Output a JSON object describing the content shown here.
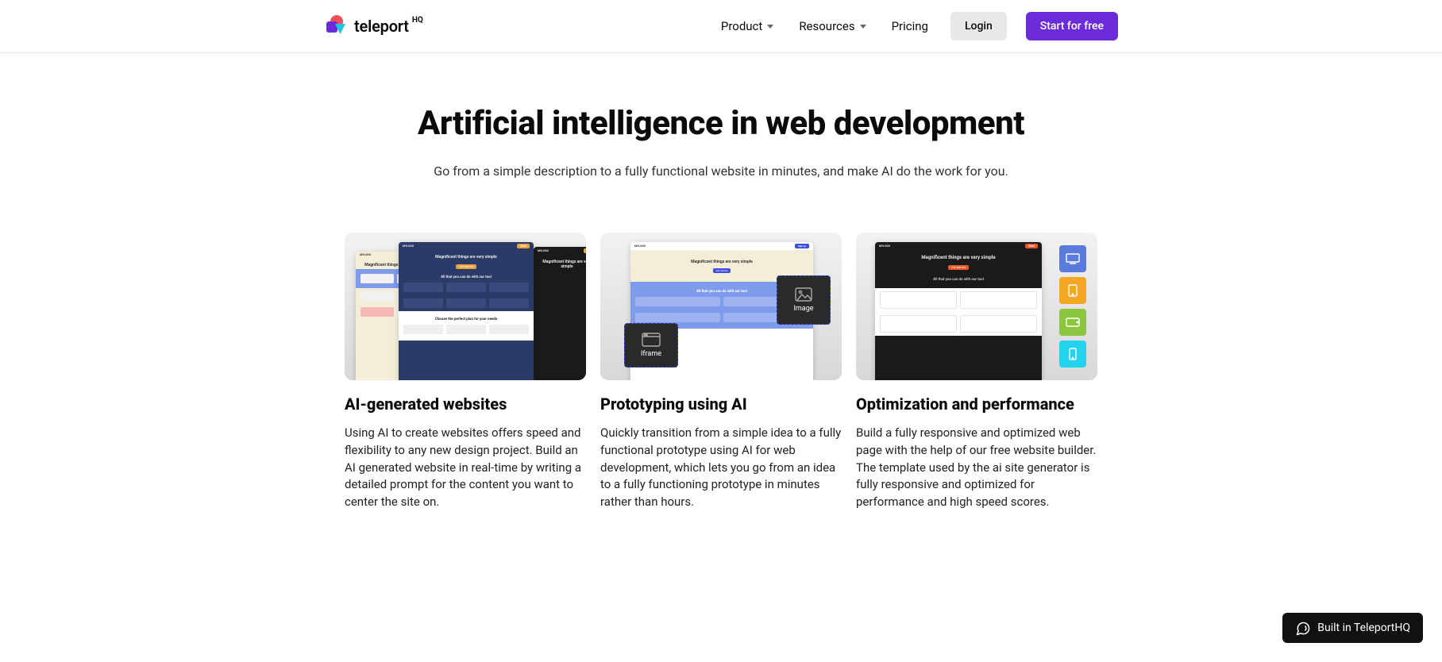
{
  "brand": {
    "name": "teleport",
    "suffix": "HQ"
  },
  "nav": {
    "product": "Product",
    "resources": "Resources",
    "pricing": "Pricing",
    "login": "Login",
    "cta": "Start for free"
  },
  "hero": {
    "title": "Artificial intelligence in web development",
    "subtitle": "Go from a simple description to a fully functional website in minutes, and make AI do the work for you."
  },
  "features": [
    {
      "title": "AI-generated websites",
      "body": "Using AI to create websites offers speed and flexibility to any new design project. Build an AI generated website in real-time by writing a detailed prompt for the content you want to center the site on."
    },
    {
      "title": "Prototyping using AI",
      "body": "Quickly transition from a simple idea to a fully functional prototype using AI for web development, which lets you go from an idea to a fully functioning prototype in minutes rather than hours."
    },
    {
      "title": "Optimization and performance",
      "body": "Build a fully responsive and optimized web page with the help of our free website builder. The template used by the ai site generator is fully responsive and optimized for performance and high speed scores."
    }
  ],
  "mock": {
    "logo": "MYLOGO",
    "headline": "Magnificent things are very simple",
    "section": "All that you can do with our tool",
    "plans": "Choose the perfect plan for your needs",
    "iframe": "Iframe",
    "image": "Image"
  },
  "badge": {
    "label": "Built in TeleportHQ"
  },
  "colors": {
    "purple": "#6C2BD9",
    "grey": "#E8E8E8",
    "chip_blue": "#5A7BDB",
    "chip_orange": "#F5A623",
    "chip_green": "#7ED321",
    "chip_cyan": "#22D3EE"
  }
}
